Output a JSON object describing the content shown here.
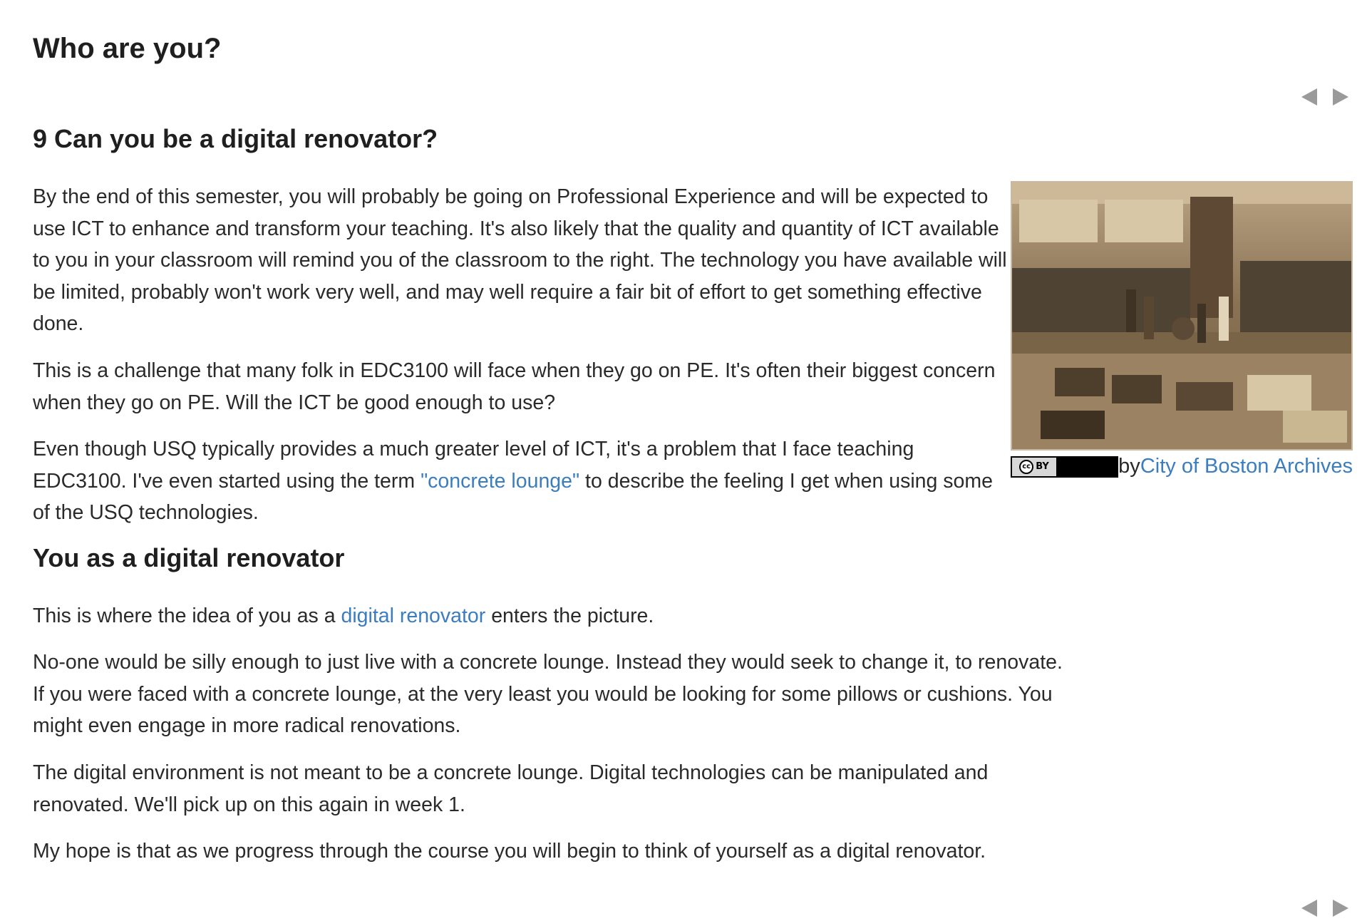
{
  "page": {
    "title": "Who are you?"
  },
  "nav": {
    "prev_icon": "triangle-left",
    "next_icon": "triangle-right"
  },
  "section": {
    "heading": "9 Can you be a digital renovator?",
    "paragraphs": [
      "By the end of this semester, you will probably be going on Professional Experience and will be expected to use ICT to enhance and transform your teaching. It's also likely that the quality and quantity of ICT available to you in your classroom will remind you of the classroom to the right. The technology you have available will be limited, probably won't work very well, and may well require a fair bit of effort to get something effective done.",
      "This is a challenge that many folk in EDC3100 will face when they go on PE. It's often their biggest concern when they go on PE. Will the ICT be good enough to use?"
    ],
    "p3": {
      "before": "Even though USQ typically provides a much greater level of ICT, it's a problem that I face teaching EDC3100. I've even started using the term ",
      "link": "\"concrete lounge\"",
      "after": " to describe the feeling I get when using some of the USQ technologies."
    }
  },
  "figure": {
    "license_left": "cc",
    "license_right": "BY",
    "by_text": "by",
    "credit_link": "City of Boston Archives"
  },
  "renovator": {
    "heading": "You as a digital renovator",
    "p1": {
      "before": "This is where the idea of you as a ",
      "link": "digital renovator",
      "after": " enters the picture."
    },
    "paragraphs": [
      "No-one would be silly enough to just live with a concrete lounge. Instead they would seek to change it, to renovate. If you were faced with a concrete lounge, at the very least you would be looking for some pillows or cushions. You might even engage in more radical renovations.",
      "The digital environment is not meant to be a concrete lounge. Digital technologies can be manipulated and renovated. We'll pick up on this again in week 1.",
      "My hope is that as we progress through the course you will begin to think of yourself as a digital renovator."
    ]
  },
  "colors": {
    "link": "#3b7dbf",
    "text": "#2a2a2a",
    "arrow": "#9a9a9a"
  }
}
